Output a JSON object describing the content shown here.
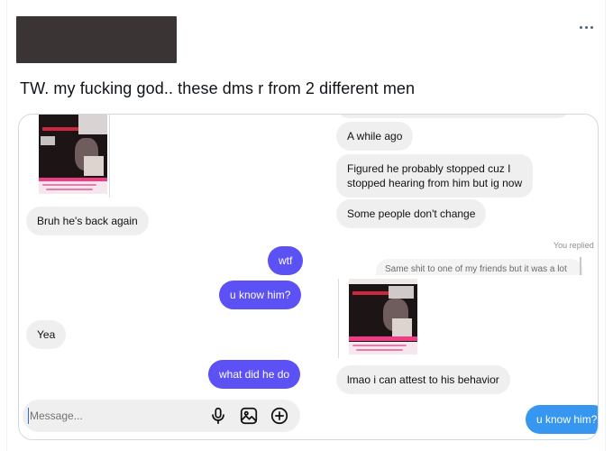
{
  "post": {
    "text": "TW. my fucking god.. these dms r from 2 different men",
    "more_icon": "ellipsis-icon"
  },
  "left_chat": {
    "messages": [
      {
        "side": "received",
        "text": "Bruh he's back again"
      },
      {
        "side": "sent",
        "text": "wtf"
      },
      {
        "side": "sent",
        "text": "u know him?"
      },
      {
        "side": "received",
        "text": "Yea"
      },
      {
        "side": "sent",
        "text": "what did he do"
      }
    ],
    "composer": {
      "placeholder": "Message...",
      "icons": [
        "microphone-icon",
        "image-icon",
        "add-circle-icon"
      ]
    },
    "colors": {
      "sent": "#5b51f5",
      "received": "#efefef"
    }
  },
  "right_chat": {
    "messages": [
      {
        "side": "received",
        "text": "A while ago"
      },
      {
        "side": "received",
        "text": "Figured he probably stopped cuz I\nstopped hearing from him but ig now"
      },
      {
        "side": "received",
        "text": "Some people don't change"
      },
      {
        "side": "received",
        "text": "lmao i can attest to his behavior"
      },
      {
        "side": "sent",
        "text": "u know him?"
      }
    ],
    "you_replied": "You replied",
    "quoted_reply": "Same shit to one of my friends but it was a lot",
    "colors": {
      "sent": "#3797f0",
      "received": "#efefef"
    }
  }
}
